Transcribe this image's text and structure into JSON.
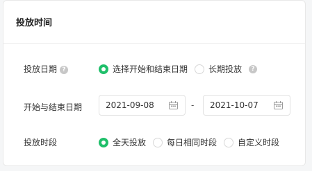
{
  "card": {
    "title": "投放时间"
  },
  "rows": {
    "date_mode": {
      "label": "投放日期",
      "options": [
        "选择开始和结束日期",
        "长期投放"
      ],
      "selected_index": 0
    },
    "date_range": {
      "label": "开始与结束日期",
      "start": "2021-09-08",
      "separator": "-",
      "end": "2021-10-07"
    },
    "time_slot": {
      "label": "投放时段",
      "options": [
        "全天投放",
        "每日相同时段",
        "自定义时段"
      ],
      "selected_index": 0
    }
  },
  "icons": {
    "help": "question-mark-icon",
    "calendar": "calendar-icon"
  },
  "colors": {
    "accent": "#1fbf6a",
    "border": "#e2e2e2"
  }
}
